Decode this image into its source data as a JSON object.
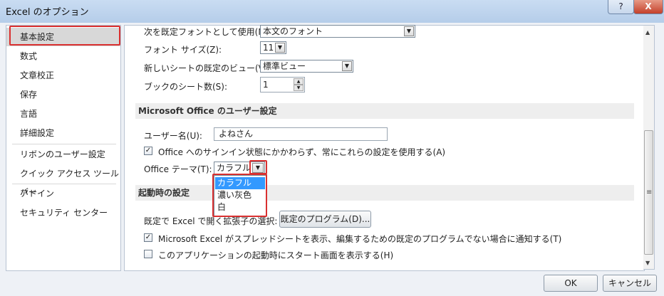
{
  "window": {
    "title": "Excel のオプション",
    "help": "?",
    "close": "X"
  },
  "sidebar": {
    "items": [
      {
        "label": "基本設定"
      },
      {
        "label": "数式"
      },
      {
        "label": "文章校正"
      },
      {
        "label": "保存"
      },
      {
        "label": "言語"
      },
      {
        "label": "詳細設定"
      },
      {
        "label": "リボンのユーザー設定"
      },
      {
        "label": "クイック アクセス ツール バー"
      },
      {
        "label": "アドイン"
      },
      {
        "label": "セキュリティ センター"
      }
    ],
    "selected_index": 0
  },
  "general": {
    "default_font_label": "次を既定フォントとして使用(N):",
    "default_font_value": "本文のフォント",
    "font_size_label": "フォント サイズ(Z):",
    "font_size_value": "11",
    "new_sheet_view_label": "新しいシートの既定のビュー(V):",
    "new_sheet_view_value": "標準ビュー",
    "sheet_count_label": "ブックのシート数(S):",
    "sheet_count_value": "1"
  },
  "user_section": {
    "heading": "Microsoft Office のユーザー設定",
    "username_label": "ユーザー名(U):",
    "username_value": "よねさん",
    "always_use_label": "Office へのサインイン状態にかかわらず、常にこれらの設定を使用する(A)",
    "always_use_checked": true,
    "theme_label": "Office テーマ(T):",
    "theme_value": "カラフル",
    "theme_options": [
      "カラフル",
      "濃い灰色",
      "白"
    ],
    "theme_selected_index": 0
  },
  "startup_section": {
    "heading": "起動時の設定",
    "default_prog_label": "既定で Excel で開く拡張子の選択:",
    "default_prog_button": "既定のプログラム(D)...",
    "notify_label": "Microsoft Excel がスプレッドシートを表示、編集するための既定のプログラムでない場合に通知する(T)",
    "notify_checked": true,
    "start_screen_label": "このアプリケーションの起動時にスタート画面を表示する(H)",
    "start_screen_checked": false
  },
  "footer": {
    "ok": "OK",
    "cancel": "キャンセル"
  },
  "colors": {
    "accent_highlight": "#3399ff",
    "callout_red": "#d93030",
    "title_bar": "#c9dcf2"
  }
}
